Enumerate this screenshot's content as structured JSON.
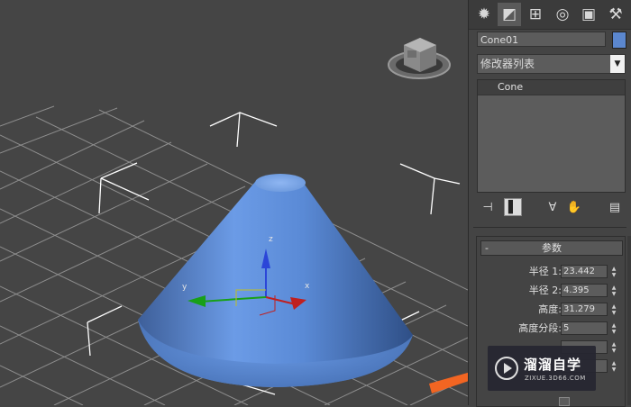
{
  "viewport": {
    "gizmo_labels": {
      "z": "z",
      "y": "y",
      "x": "x"
    }
  },
  "command_panel": {
    "tabs": [
      {
        "name": "create-tab",
        "icon": "sun-icon",
        "glyph": "✹"
      },
      {
        "name": "modify-tab",
        "icon": "modify-icon",
        "glyph": "◩"
      },
      {
        "name": "hierarchy-tab",
        "icon": "hierarchy-icon",
        "glyph": "⊞"
      },
      {
        "name": "motion-tab",
        "icon": "motion-icon",
        "glyph": "◎"
      },
      {
        "name": "display-tab",
        "icon": "display-icon",
        "glyph": "▣"
      },
      {
        "name": "utilities-tab",
        "icon": "hammer-icon",
        "glyph": "⚒"
      }
    ],
    "object_name": "Cone01",
    "object_color": "#5b87cf",
    "modifier_list_label": "修改器列表",
    "modifier_stack": [
      "Cone"
    ],
    "parameters": {
      "title": "参数",
      "rows": [
        {
          "label": "半径 1:",
          "value": "23.442"
        },
        {
          "label": "半径 2:",
          "value": "4.395"
        },
        {
          "label": "高度:",
          "value": "31.279"
        },
        {
          "label": "高度分段:",
          "value": "5"
        }
      ]
    }
  },
  "watermark": {
    "title": "溜溜自学",
    "subtitle": "ZIXUE.3D66.COM"
  },
  "colors": {
    "cone": "#4f7fc9",
    "viewport_bg": "#454545",
    "grid": "#9a9a9a",
    "arrow": "#f26522"
  }
}
